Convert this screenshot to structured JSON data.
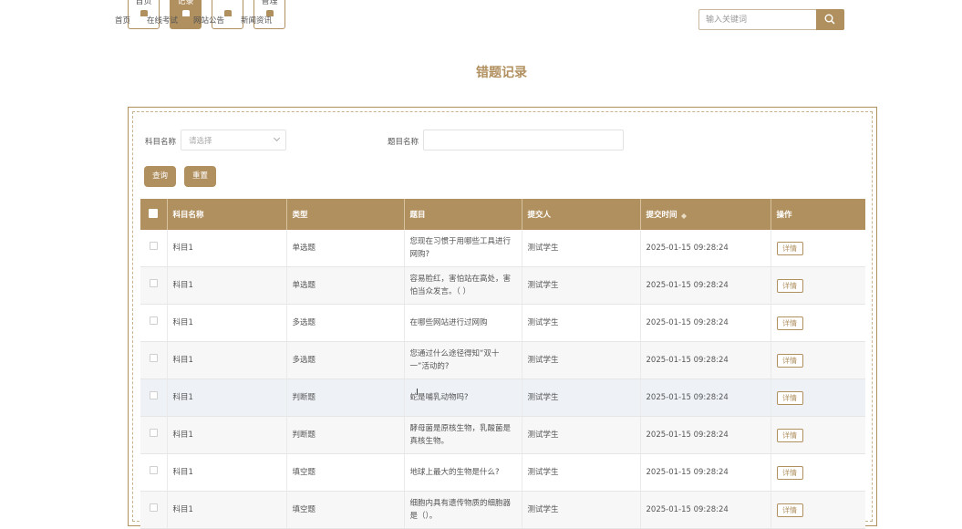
{
  "nav": {
    "boxes": [
      {
        "label": "首页"
      },
      {
        "label": "记录"
      },
      {
        "label": ""
      },
      {
        "label": "管理"
      }
    ],
    "links": [
      "首页",
      "在线考试",
      "网站公告",
      "新闻资讯"
    ]
  },
  "search": {
    "placeholder": "输入关键词"
  },
  "page_title": "错题记录",
  "filters": {
    "subject_label": "科目名称",
    "subject_placeholder": "请选择",
    "question_label": "题目名称",
    "query_button": "查询",
    "reset_button": "重置"
  },
  "table": {
    "headers": [
      "科目名称",
      "类型",
      "题目",
      "提交人",
      "提交时间",
      "操作"
    ],
    "rows": [
      {
        "subject": "科目1",
        "type": "单选题",
        "question": "您现在习惯于用哪些工具进行网购?",
        "submitter": "测试学生",
        "time": "2025-01-15 09:28:24",
        "action": "详情"
      },
      {
        "subject": "科目1",
        "type": "单选题",
        "question": "容易脸红，害怕站在高处，害怕当众发言。（ ）",
        "submitter": "测试学生",
        "time": "2025-01-15 09:28:24",
        "action": "详情"
      },
      {
        "subject": "科目1",
        "type": "多选题",
        "question": "在哪些网站进行过网购",
        "submitter": "测试学生",
        "time": "2025-01-15 09:28:24",
        "action": "详情"
      },
      {
        "subject": "科目1",
        "type": "多选题",
        "question": "您通过什么途径得知“双十一”活动的?",
        "submitter": "测试学生",
        "time": "2025-01-15 09:28:24",
        "action": "详情"
      },
      {
        "subject": "科目1",
        "type": "判断题",
        "question": "蛇是哺乳动物吗?",
        "submitter": "测试学生",
        "time": "2025-01-15 09:28:24",
        "action": "详情"
      },
      {
        "subject": "科目1",
        "type": "判断题",
        "question": "酵母菌是原核生物，乳酸菌是真核生物。",
        "submitter": "测试学生",
        "time": "2025-01-15 09:28:24",
        "action": "详情"
      },
      {
        "subject": "科目1",
        "type": "填空题",
        "question": "地球上最大的生物是什么?",
        "submitter": "测试学生",
        "time": "2025-01-15 09:28:24",
        "action": "详情"
      },
      {
        "subject": "科目1",
        "type": "填空题",
        "question": "细胞内具有遗传物质的细胞器是（）。",
        "submitter": "测试学生",
        "time": "2025-01-15 09:28:24",
        "action": "详情"
      }
    ]
  },
  "colors": {
    "accent": "#b1905f"
  }
}
